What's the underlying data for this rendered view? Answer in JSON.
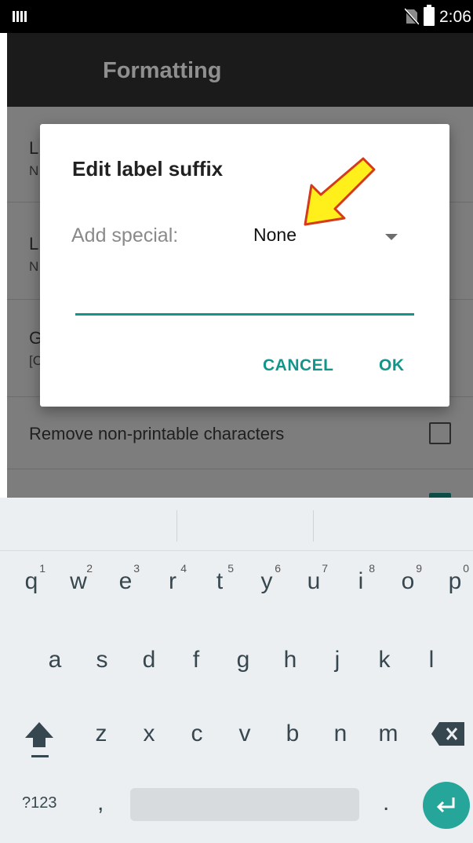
{
  "status_bar": {
    "time": "2:06"
  },
  "app_bar": {
    "title": "Formatting"
  },
  "settings": {
    "row1": {
      "title_partial": "L",
      "sub_partial": "N"
    },
    "row2": {
      "title_partial": "L",
      "sub_partial": "N"
    },
    "row3": {
      "title_partial": "G",
      "sub_partial": "[C"
    },
    "row4": {
      "title": "Remove non-printable characters"
    }
  },
  "dialog": {
    "title": "Edit label suffix",
    "special_label": "Add special:",
    "special_value": "None",
    "input_value": "",
    "cancel_label": "CANCEL",
    "ok_label": "OK"
  },
  "keyboard": {
    "row1": [
      {
        "k": "q",
        "h": "1"
      },
      {
        "k": "w",
        "h": "2"
      },
      {
        "k": "e",
        "h": "3"
      },
      {
        "k": "r",
        "h": "4"
      },
      {
        "k": "t",
        "h": "5"
      },
      {
        "k": "y",
        "h": "6"
      },
      {
        "k": "u",
        "h": "7"
      },
      {
        "k": "i",
        "h": "8"
      },
      {
        "k": "o",
        "h": "9"
      },
      {
        "k": "p",
        "h": "0"
      }
    ],
    "row2": [
      "a",
      "s",
      "d",
      "f",
      "g",
      "h",
      "j",
      "k",
      "l"
    ],
    "row3": [
      "z",
      "x",
      "c",
      "v",
      "b",
      "n",
      "m"
    ],
    "symbols_label": "?123",
    "comma": ",",
    "period": "."
  },
  "colors": {
    "accent": "#13958b",
    "enter": "#26a69a"
  }
}
